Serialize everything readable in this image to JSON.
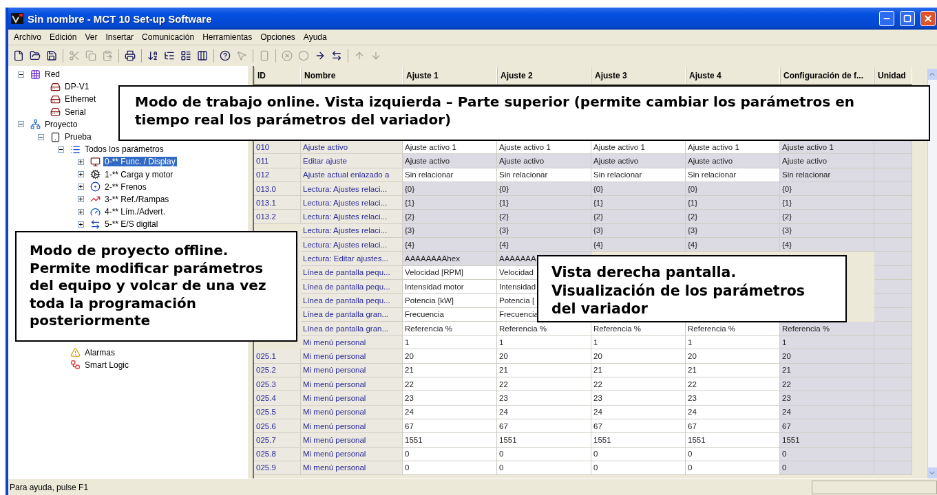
{
  "window": {
    "title": "Sin nombre - MCT 10 Set-up Software"
  },
  "menu": [
    "Archivo",
    "Edición",
    "Ver",
    "Insertar",
    "Comunicación",
    "Herramientas",
    "Opciones",
    "Ayuda"
  ],
  "toolbar": [
    {
      "kind": "new",
      "disabled": false
    },
    {
      "kind": "open",
      "disabled": false
    },
    {
      "kind": "save",
      "disabled": false
    },
    {
      "kind": "separator"
    },
    {
      "kind": "cut",
      "disabled": true
    },
    {
      "kind": "copy",
      "disabled": true
    },
    {
      "kind": "paste",
      "disabled": true
    },
    {
      "kind": "separator"
    },
    {
      "kind": "print",
      "disabled": false
    },
    {
      "kind": "separator"
    },
    {
      "kind": "sort",
      "disabled": false
    },
    {
      "kind": "tree",
      "disabled": false
    },
    {
      "kind": "list",
      "disabled": false
    },
    {
      "kind": "columns",
      "disabled": false
    },
    {
      "kind": "separator"
    },
    {
      "kind": "help",
      "disabled": false
    },
    {
      "kind": "pointer-help",
      "disabled": true
    },
    {
      "kind": "separator"
    },
    {
      "kind": "device",
      "disabled": true
    },
    {
      "kind": "separator"
    },
    {
      "kind": "stop",
      "disabled": true
    },
    {
      "kind": "record",
      "disabled": true
    },
    {
      "kind": "arrow",
      "disabled": false
    },
    {
      "kind": "transfer",
      "disabled": false
    },
    {
      "kind": "separator"
    },
    {
      "kind": "up",
      "disabled": true
    },
    {
      "kind": "down",
      "disabled": true
    }
  ],
  "tree": [
    {
      "label": "Red",
      "kind": "grid",
      "expanded": true,
      "selected": false,
      "children": [
        {
          "label": "DP-V1",
          "kind": "drive",
          "selected": false
        },
        {
          "label": "Ethernet",
          "kind": "drive",
          "selected": false
        },
        {
          "label": "Serial",
          "kind": "drive",
          "selected": false
        }
      ]
    },
    {
      "label": "Proyecto",
      "kind": "project",
      "expanded": true,
      "selected": false,
      "children": [
        {
          "label": "Prueba",
          "kind": "device",
          "expanded": true,
          "selected": false,
          "children": [
            {
              "label": "Todos los parámetros",
              "kind": "list",
              "expanded": true,
              "selected": false,
              "children": [
                {
                  "label": "0-** Func. / Display",
                  "kind": "display",
                  "expanded": false,
                  "selected": true
                },
                {
                  "label": "1-** Carga y motor",
                  "kind": "motor",
                  "expanded": false,
                  "selected": false
                },
                {
                  "label": "2-** Frenos",
                  "kind": "brake",
                  "expanded": false,
                  "selected": false
                },
                {
                  "label": "3-** Ref./Rampas",
                  "kind": "ramp",
                  "expanded": false,
                  "selected": false
                },
                {
                  "label": "4-** Lím./Advert.",
                  "kind": "limit",
                  "expanded": false,
                  "selected": false
                },
                {
                  "label": "5-** E/S digital",
                  "kind": "io",
                  "expanded": false,
                  "selected": false
                }
              ]
            },
            {
              "label": "Alarmas",
              "kind": "alarm",
              "selected": false
            },
            {
              "label": "Smart Logic",
              "kind": "logic",
              "selected": false
            }
          ]
        }
      ]
    }
  ],
  "table": {
    "columns": [
      "ID",
      "Nombre",
      "Ajuste 1",
      "Ajuste 2",
      "Ajuste 3",
      "Ajuste 4",
      "Configuración de f...",
      "Unidad"
    ],
    "rows": [
      {
        "readonly": false,
        "cells": [
          "010",
          "Ajuste activo",
          "Ajuste activo 1",
          "Ajuste activo 1",
          "Ajuste activo 1",
          "Ajuste activo 1",
          "Ajuste activo 1",
          ""
        ]
      },
      {
        "readonly": true,
        "cells": [
          "011",
          "Editar ajuste",
          "Ajuste activo",
          "Ajuste activo",
          "Ajuste activo",
          "Ajuste activo",
          "Ajuste activo",
          ""
        ]
      },
      {
        "readonly": false,
        "cells": [
          "012",
          "Ajuste actual enlazado a",
          "Sin relacionar",
          "Sin relacionar",
          "Sin relacionar",
          "Sin relacionar",
          "Sin relacionar",
          ""
        ]
      },
      {
        "readonly": true,
        "cells": [
          "013.0",
          "Lectura: Ajustes relaci...",
          "{0}",
          "{0}",
          "{0}",
          "{0}",
          "{0}",
          ""
        ]
      },
      {
        "readonly": true,
        "cells": [
          "013.1",
          "Lectura: Ajustes relaci...",
          "{1}",
          "{1}",
          "{1}",
          "{1}",
          "{1}",
          ""
        ]
      },
      {
        "readonly": true,
        "cells": [
          "013.2",
          "Lectura: Ajustes relaci...",
          "{2}",
          "{2}",
          "{2}",
          "{2}",
          "{2}",
          ""
        ]
      },
      {
        "readonly": true,
        "cells": [
          null,
          "Lectura: Ajustes relaci...",
          "{3}",
          "{3}",
          "{3}",
          "{3}",
          "{3}",
          ""
        ]
      },
      {
        "readonly": true,
        "cells": [
          null,
          "Lectura: Ajustes relaci...",
          "{4}",
          "{4}",
          "{4}",
          "{4}",
          "{4}",
          ""
        ]
      },
      {
        "readonly": true,
        "cells": [
          null,
          "Lectura: Editar ajustes...",
          "AAAAAAAAhex",
          "AAAAAAA",
          null,
          null,
          null,
          ""
        ]
      },
      {
        "readonly": false,
        "cells": [
          null,
          "Línea de pantalla pequ...",
          "Velocidad [RPM]",
          "Velocidad",
          null,
          null,
          null,
          ""
        ]
      },
      {
        "readonly": false,
        "cells": [
          null,
          "Línea de pantalla pequ...",
          "Intensidad motor",
          "Intensidad",
          null,
          null,
          null,
          ""
        ]
      },
      {
        "readonly": false,
        "cells": [
          null,
          "Línea de pantalla pequ...",
          "Potencia [kW]",
          "Potencia [",
          null,
          null,
          null,
          ""
        ]
      },
      {
        "readonly": false,
        "cells": [
          null,
          "Línea de pantalla gran...",
          "Frecuencia",
          "Frecuencia",
          null,
          null,
          null,
          ""
        ]
      },
      {
        "readonly": false,
        "cells": [
          null,
          "Línea de pantalla gran...",
          "Referencia %",
          "Referencia %",
          "Referencia %",
          "Referencia %",
          "Referencia %",
          ""
        ]
      },
      {
        "readonly": false,
        "cells": [
          null,
          "Mi menú personal",
          "1",
          "1",
          "1",
          "1",
          "1",
          ""
        ]
      },
      {
        "readonly": false,
        "cells": [
          "025.1",
          "Mi menú personal",
          "20",
          "20",
          "20",
          "20",
          "20",
          ""
        ]
      },
      {
        "readonly": false,
        "cells": [
          "025.2",
          "Mi menú personal",
          "21",
          "21",
          "21",
          "21",
          "21",
          ""
        ]
      },
      {
        "readonly": false,
        "cells": [
          "025.3",
          "Mi menú personal",
          "22",
          "22",
          "22",
          "22",
          "22",
          ""
        ]
      },
      {
        "readonly": false,
        "cells": [
          "025.4",
          "Mi menú personal",
          "23",
          "23",
          "23",
          "23",
          "23",
          ""
        ]
      },
      {
        "readonly": false,
        "cells": [
          "025.5",
          "Mi menú personal",
          "24",
          "24",
          "24",
          "24",
          "24",
          ""
        ]
      },
      {
        "readonly": false,
        "cells": [
          "025.6",
          "Mi menú personal",
          "67",
          "67",
          "67",
          "67",
          "67",
          ""
        ]
      },
      {
        "readonly": false,
        "cells": [
          "025.7",
          "Mi menú personal",
          "1551",
          "1551",
          "1551",
          "1551",
          "1551",
          ""
        ]
      },
      {
        "readonly": false,
        "cells": [
          "025.8",
          "Mi menú personal",
          "0",
          "0",
          "0",
          "0",
          "0",
          ""
        ]
      },
      {
        "readonly": false,
        "cells": [
          "025.9",
          "Mi menú personal",
          "0",
          "0",
          "0",
          "0",
          "0",
          ""
        ]
      }
    ]
  },
  "callouts": [
    {
      "kind": "top",
      "text": "Modo de trabajo online. Vista izquierda – Parte superior (permite cambiar los parámetros en tiempo real los parámetros del variador)"
    },
    {
      "kind": "left",
      "text": "Modo de proyecto offline. Permite modificar parámetros del equipo y volcar de una vez toda la programación posteriormente"
    },
    {
      "kind": "right",
      "text": "Vista derecha pantalla. Visualización de los parámetros del variador"
    }
  ],
  "status_bar": {
    "text": "Para ayuda, pulse F1"
  }
}
